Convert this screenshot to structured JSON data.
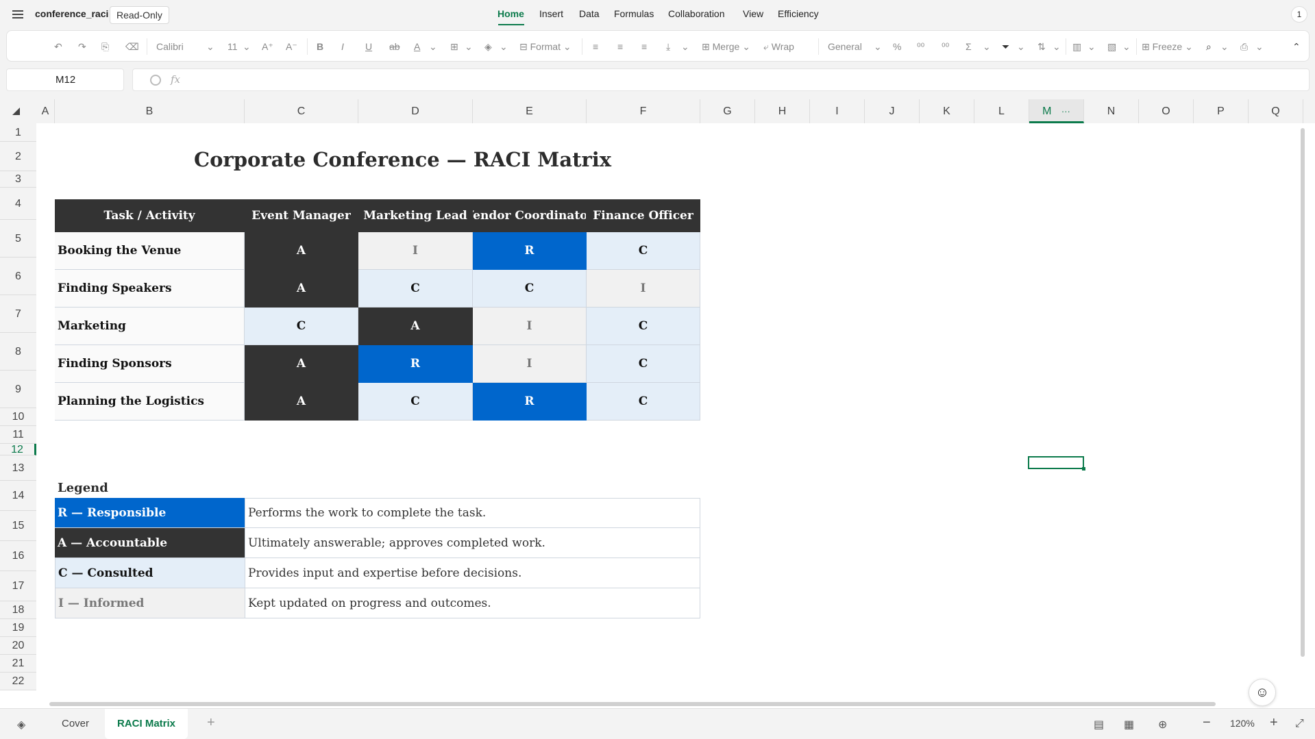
{
  "app": {
    "doc_name": "conference_raci",
    "mode_badge": "Read-Only",
    "notification_count": "1"
  },
  "menu": {
    "items": [
      "Home",
      "Insert",
      "Data",
      "Formulas",
      "Collaboration",
      "View",
      "Efficiency"
    ],
    "active": "Home"
  },
  "toolbar": {
    "font": "Calibri",
    "size": "11",
    "format": "Format",
    "merge": "Merge",
    "wrap": "Wrap",
    "number_format": "General",
    "percent": "%",
    "freeze": "Freeze"
  },
  "formula_bar": {
    "name_box": "M12",
    "fx": "fx",
    "value": ""
  },
  "columns": [
    "A",
    "B",
    "C",
    "D",
    "E",
    "F",
    "G",
    "H",
    "I",
    "J",
    "K",
    "L",
    "M",
    "N",
    "O",
    "P",
    "Q"
  ],
  "selected_column": "M",
  "col_more": "···",
  "rows": [
    "1",
    "2",
    "3",
    "4",
    "5",
    "6",
    "7",
    "8",
    "9",
    "10",
    "11",
    "12",
    "13",
    "14",
    "15",
    "16",
    "17",
    "18",
    "19",
    "20",
    "21",
    "22"
  ],
  "selected_row": "12",
  "sheet": {
    "title": "Corporate Conference — RACI Matrix",
    "headers": [
      "Task / Activity",
      "Event Manager",
      "Marketing Lead",
      "Vendor Coordinator",
      "Finance Officer"
    ],
    "tasks": [
      {
        "task": "Booking the Venue",
        "roles": [
          "A",
          "I",
          "R",
          "C"
        ]
      },
      {
        "task": "Finding Speakers",
        "roles": [
          "A",
          "C",
          "C",
          "I"
        ]
      },
      {
        "task": "Marketing",
        "roles": [
          "C",
          "A",
          "I",
          "C"
        ]
      },
      {
        "task": "Finding Sponsors",
        "roles": [
          "A",
          "R",
          "I",
          "C"
        ]
      },
      {
        "task": "Planning the Logistics",
        "roles": [
          "A",
          "C",
          "R",
          "C"
        ]
      }
    ],
    "legend_title": "Legend",
    "legend": [
      {
        "key": "R — Responsible",
        "desc": "Performs the work to complete the task.",
        "code": "R"
      },
      {
        "key": "A — Accountable",
        "desc": "Ultimately answerable; approves completed work.",
        "code": "A"
      },
      {
        "key": "C — Consulted",
        "desc": "Provides input and expertise before decisions.",
        "code": "C"
      },
      {
        "key": "I — Informed",
        "desc": "Kept updated on progress and outcomes.",
        "code": "I"
      }
    ]
  },
  "colors": {
    "accent": "#0b7a4b",
    "responsible": "#0066cc",
    "accountable": "#333333",
    "consulted": "#e4eef8",
    "informed": "#f1f1f1"
  },
  "sheets": {
    "tabs": [
      "Cover",
      "RACI Matrix"
    ],
    "active": "RACI Matrix"
  },
  "status": {
    "zoom": "120%"
  }
}
